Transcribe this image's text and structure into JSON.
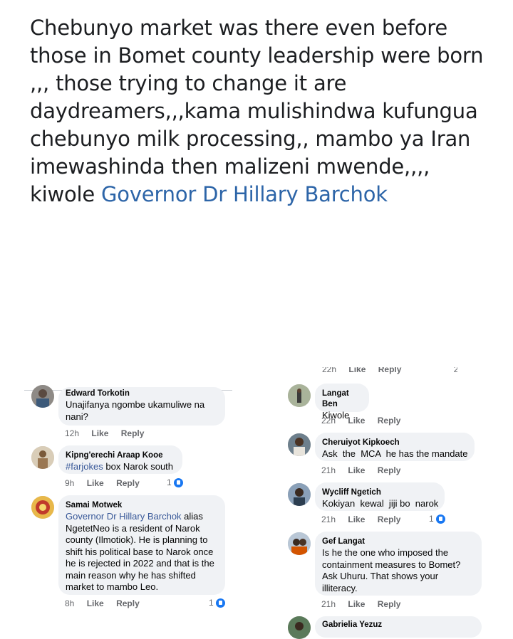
{
  "post": {
    "text": "Chebunyo market was there even before those in Bomet county leadership were born ,,, those trying to change it are daydreamers,,,kama mulishindwa kufungua chebunyo milk processing,, mambo ya Iran imewashinda then malizeni mwende,,,, kiwole ",
    "tag": "Governor Dr Hillary Barchok"
  },
  "left_comments": [
    {
      "name": "Edward Torkotin",
      "text": "Unajifanya ngombe ukamuliwe na nani?",
      "time": "12h",
      "like": "Like",
      "reply": "Reply"
    },
    {
      "name": "Kipng'erechi Araap Kooe",
      "tag": "#farjokes",
      "text": " box Narok south",
      "time": "9h",
      "like": "Like",
      "reply": "Reply",
      "reactions": "1"
    },
    {
      "name": "Samai Motwek",
      "tag": "Governor Dr Hillary Barchok",
      "text": " alias NgetetNeo is a resident of Narok county (Ilmotiok). He is planning to shift his political base to Narok once he is rejected in 2022 and that is the main reason why he has shifted market to mambo Leo.",
      "time": "8h",
      "like": "Like",
      "reply": "Reply",
      "reactions": "1"
    }
  ],
  "right_top_clip": {
    "time": "22h",
    "like": "Like",
    "reply": "Reply",
    "reactions": "2"
  },
  "right_comments": [
    {
      "name": "Langat Ben",
      "text": "Kiwole",
      "time": "22h",
      "like": "Like",
      "reply": "Reply"
    },
    {
      "name": "Cheruiyot Kipkoech",
      "text": "Ask  the  MCA  he has the mandate",
      "time": "21h",
      "like": "Like",
      "reply": "Reply"
    },
    {
      "name": "Wycliff Ngetich",
      "text": "Kokiyan  kewal  jiji bo  narok",
      "time": "21h",
      "like": "Like",
      "reply": "Reply",
      "reactions": "1"
    },
    {
      "name": "Gef Langat",
      "text": "Is he the one who imposed the containment measures to Bomet? Ask Uhuru. That shows your illiteracy.",
      "time": "21h",
      "like": "Like",
      "reply": "Reply"
    },
    {
      "name": "Gabrielia Yezuz"
    }
  ]
}
